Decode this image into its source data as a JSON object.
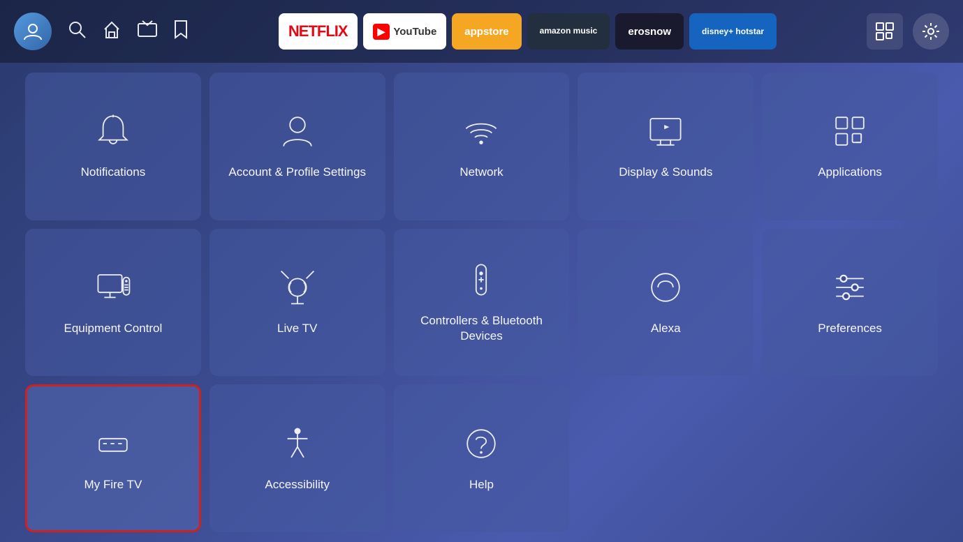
{
  "header": {
    "apps": [
      {
        "id": "netflix",
        "label": "NETFLIX",
        "class": "app-netflix"
      },
      {
        "id": "youtube",
        "label": "YouTube",
        "class": "app-youtube"
      },
      {
        "id": "appstore",
        "label": "appstore",
        "class": "app-appstore"
      },
      {
        "id": "amazon-music",
        "label": "amazon music",
        "class": "app-amazon-music"
      },
      {
        "id": "erosnow",
        "label": "erosnow",
        "class": "app-erosnow"
      },
      {
        "id": "hotstar",
        "label": "disney+ hotstar",
        "class": "app-hotstar"
      }
    ]
  },
  "grid": {
    "items": [
      {
        "id": "notifications",
        "label": "Notifications",
        "icon": "bell",
        "selected": false
      },
      {
        "id": "account-profile",
        "label": "Account & Profile Settings",
        "icon": "person",
        "selected": false
      },
      {
        "id": "network",
        "label": "Network",
        "icon": "wifi",
        "selected": false
      },
      {
        "id": "display-sounds",
        "label": "Display & Sounds",
        "icon": "display",
        "selected": false
      },
      {
        "id": "applications",
        "label": "Applications",
        "icon": "apps",
        "selected": false
      },
      {
        "id": "equipment-control",
        "label": "Equipment Control",
        "icon": "monitor",
        "selected": false
      },
      {
        "id": "live-tv",
        "label": "Live TV",
        "icon": "antenna",
        "selected": false
      },
      {
        "id": "controllers-bluetooth",
        "label": "Controllers & Bluetooth Devices",
        "icon": "remote",
        "selected": false
      },
      {
        "id": "alexa",
        "label": "Alexa",
        "icon": "alexa",
        "selected": false
      },
      {
        "id": "preferences",
        "label": "Preferences",
        "icon": "sliders",
        "selected": false
      },
      {
        "id": "my-fire-tv",
        "label": "My Fire TV",
        "icon": "firetv",
        "selected": true
      },
      {
        "id": "accessibility",
        "label": "Accessibility",
        "icon": "accessibility",
        "selected": false
      },
      {
        "id": "help",
        "label": "Help",
        "icon": "help",
        "selected": false
      }
    ]
  }
}
